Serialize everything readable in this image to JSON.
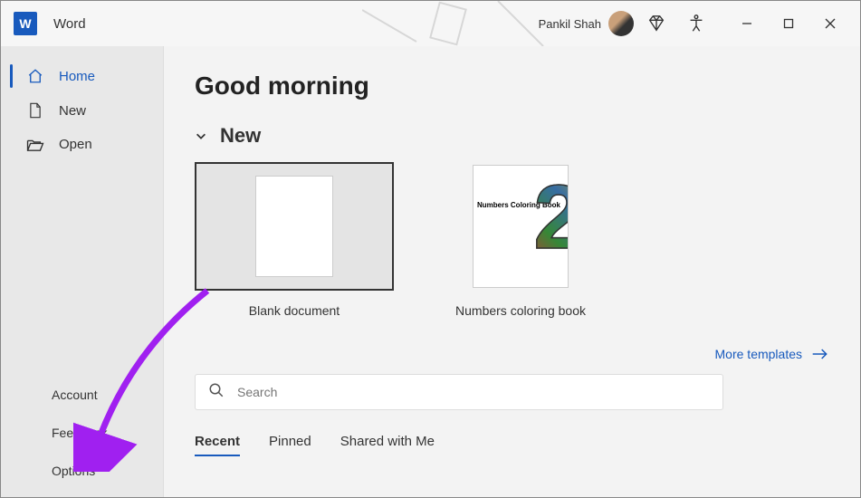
{
  "titlebar": {
    "app_name": "Word",
    "app_icon_letter": "W",
    "user_name": "Pankil Shah"
  },
  "sidebar": {
    "items": [
      {
        "label": "Home",
        "icon": "home"
      },
      {
        "label": "New",
        "icon": "new-doc"
      },
      {
        "label": "Open",
        "icon": "folder"
      }
    ],
    "bottom_items": [
      {
        "label": "Account"
      },
      {
        "label": "Feedback"
      },
      {
        "label": "Options"
      }
    ]
  },
  "main": {
    "greeting": "Good morning",
    "section_new": "New",
    "templates": [
      {
        "label": "Blank document"
      },
      {
        "label": "Numbers coloring book",
        "side_text": "Numbers Coloring Book"
      }
    ],
    "more_templates": "More templates",
    "search": {
      "placeholder": "Search"
    },
    "tabs": [
      {
        "label": "Recent",
        "active": true
      },
      {
        "label": "Pinned"
      },
      {
        "label": "Shared with Me"
      }
    ]
  },
  "colors": {
    "accent": "#185abd",
    "annotation": "#a020f0"
  }
}
